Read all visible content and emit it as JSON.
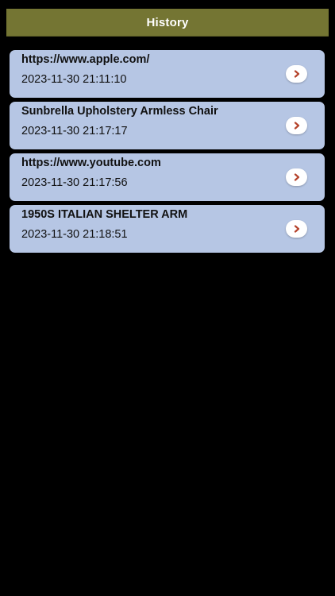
{
  "header": {
    "title": "History"
  },
  "history": [
    {
      "title": "https://www.apple.com/",
      "time": "2023-11-30 21:11:10"
    },
    {
      "title": "Sunbrella Upholstery Armless Chair",
      "time": "2023-11-30 21:17:17"
    },
    {
      "title": "https://www.youtube.com",
      "time": "2023-11-30 21:17:56"
    },
    {
      "title": "1950S ITALIAN SHELTER ARM",
      "time": "2023-11-30 21:18:51"
    }
  ],
  "icons": {
    "chevron": "chevron-right-icon"
  },
  "colors": {
    "header_bg": "#747533",
    "card_bg": "#b6c6e4",
    "chevron": "#b5432c",
    "background": "#000000"
  }
}
